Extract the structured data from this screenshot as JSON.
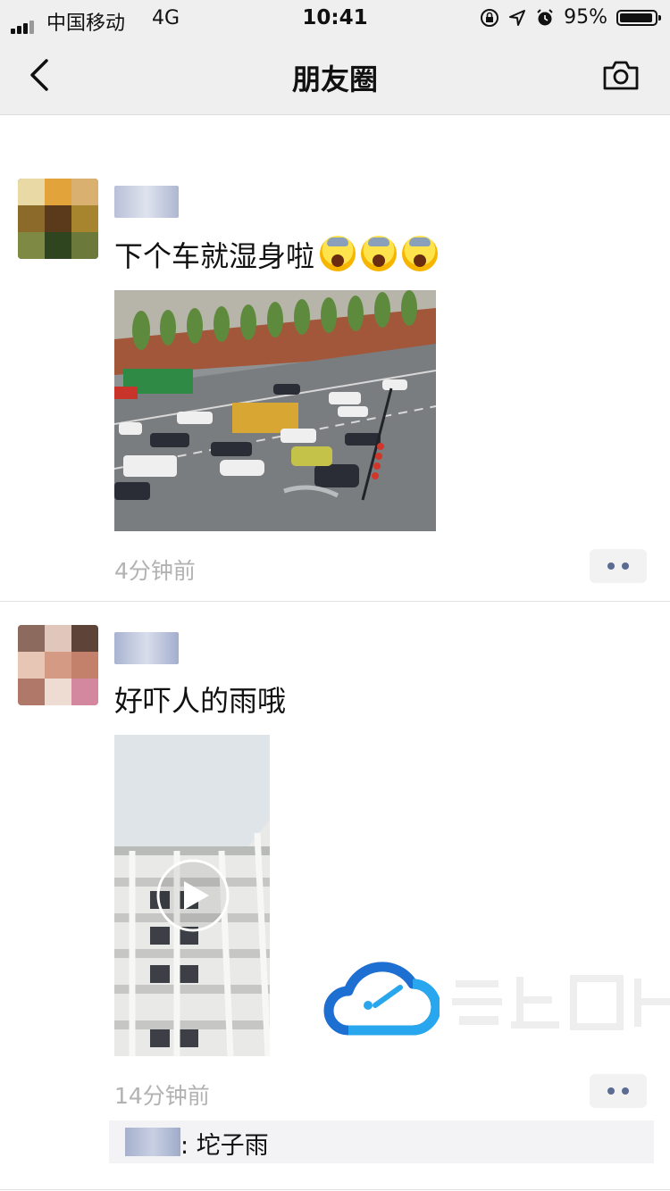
{
  "status_bar": {
    "carrier": "中国移动",
    "network": "4G",
    "time": "10:41",
    "battery": "95%"
  },
  "navbar": {
    "title": "朋友圈",
    "back_icon": "back-chevron-icon",
    "camera_icon": "camera-icon"
  },
  "posts": [
    {
      "text": "下个车就湿身啦",
      "emoji_count": 3,
      "time": "4分钟前",
      "media_type": "photo"
    },
    {
      "text": "好吓人的雨哦",
      "time": "14分钟前",
      "media_type": "video",
      "comments": [
        {
          "text": ": 坨子雨"
        }
      ]
    }
  ],
  "colors": {
    "bar_background": "#efefef",
    "timestamp": "#b2b2b2",
    "more_dots": "#5b6b92",
    "comment_background": "#f3f3f5"
  }
}
